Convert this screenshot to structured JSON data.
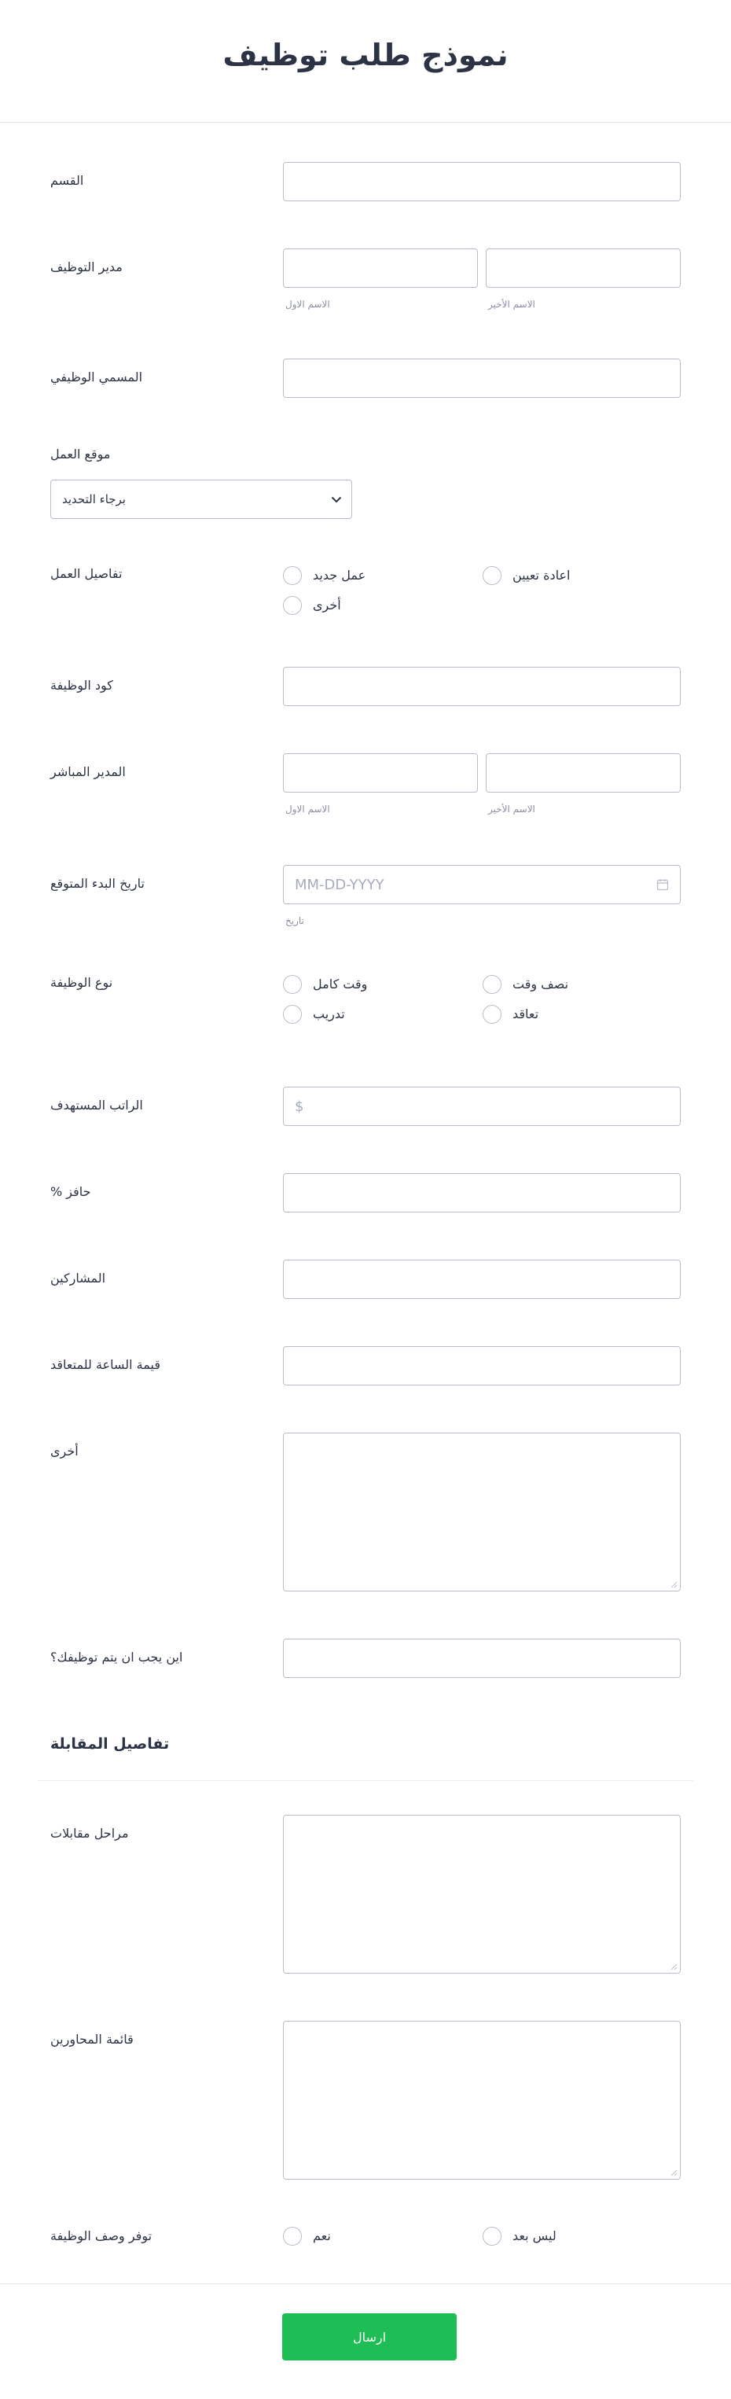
{
  "form": {
    "title": "نموذج طلب توظيف",
    "submit_label": "ارسال"
  },
  "fields": {
    "department": {
      "label": "القسم"
    },
    "hiring_manager": {
      "label": "مدير التوظيف",
      "first_name": "الاسم الاول",
      "last_name": "الاسم الأخير"
    },
    "job_title": {
      "label": "المسمي الوظيفي"
    },
    "work_location": {
      "label": "موقع العمل",
      "selected": "برجاء التحديد"
    },
    "work_details": {
      "label": "تفاصيل العمل",
      "options": [
        "عمل جديد",
        "اعادة تعيين",
        "أخرى"
      ]
    },
    "job_code": {
      "label": "كود الوظيفة"
    },
    "direct_manager": {
      "label": "المدير المباشر",
      "first_name": "الاسم الاول",
      "last_name": "الاسم الأخير"
    },
    "start_date": {
      "label": "تاريخ البدء المتوقع",
      "placeholder": "MM-DD-YYYY",
      "sublabel": "تاريخ"
    },
    "job_type": {
      "label": "نوع الوظيفة",
      "options": [
        "وقت كامل",
        "نصف وقت",
        "تدريب",
        "تعاقد"
      ]
    },
    "target_salary": {
      "label": "الراتب المستهدف",
      "prefix": "$"
    },
    "incentive": {
      "label": "% حافز"
    },
    "participants": {
      "label": "المشاركين"
    },
    "contractor_hourly_rate": {
      "label": "قيمة الساعة للمتعاقد"
    },
    "other": {
      "label": "أخرى"
    },
    "where_hire": {
      "label": "اين يجب ان يتم توظيفك؟"
    }
  },
  "interview": {
    "section_title": "تفاصيل المقابلة",
    "stages": {
      "label": "مراحل مقابلات"
    },
    "interviewers": {
      "label": "قائمة المحاورين"
    },
    "job_description": {
      "label": "توفر وصف الوظيفة",
      "options": [
        "نعم",
        "ليس بعد"
      ]
    }
  },
  "colors": {
    "submit": "#1fbd55",
    "text": "#2c3345",
    "border": "#b8bdc9"
  }
}
